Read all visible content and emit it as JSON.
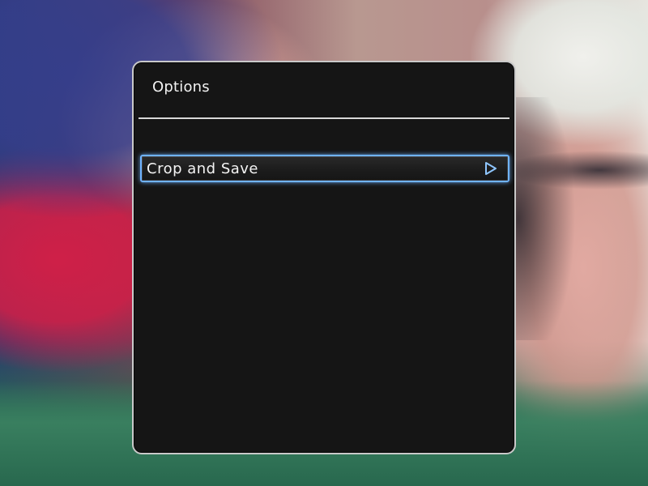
{
  "dialog": {
    "title": "Options",
    "items": [
      {
        "label": "Crop and Save",
        "selected": true,
        "icon": "chevron-right-icon"
      }
    ]
  },
  "colors": {
    "panel_background": "#151515",
    "panel_border": "#c9c9c9",
    "selection_highlight": "#6fb3ff",
    "text": "#f2f2f2"
  }
}
